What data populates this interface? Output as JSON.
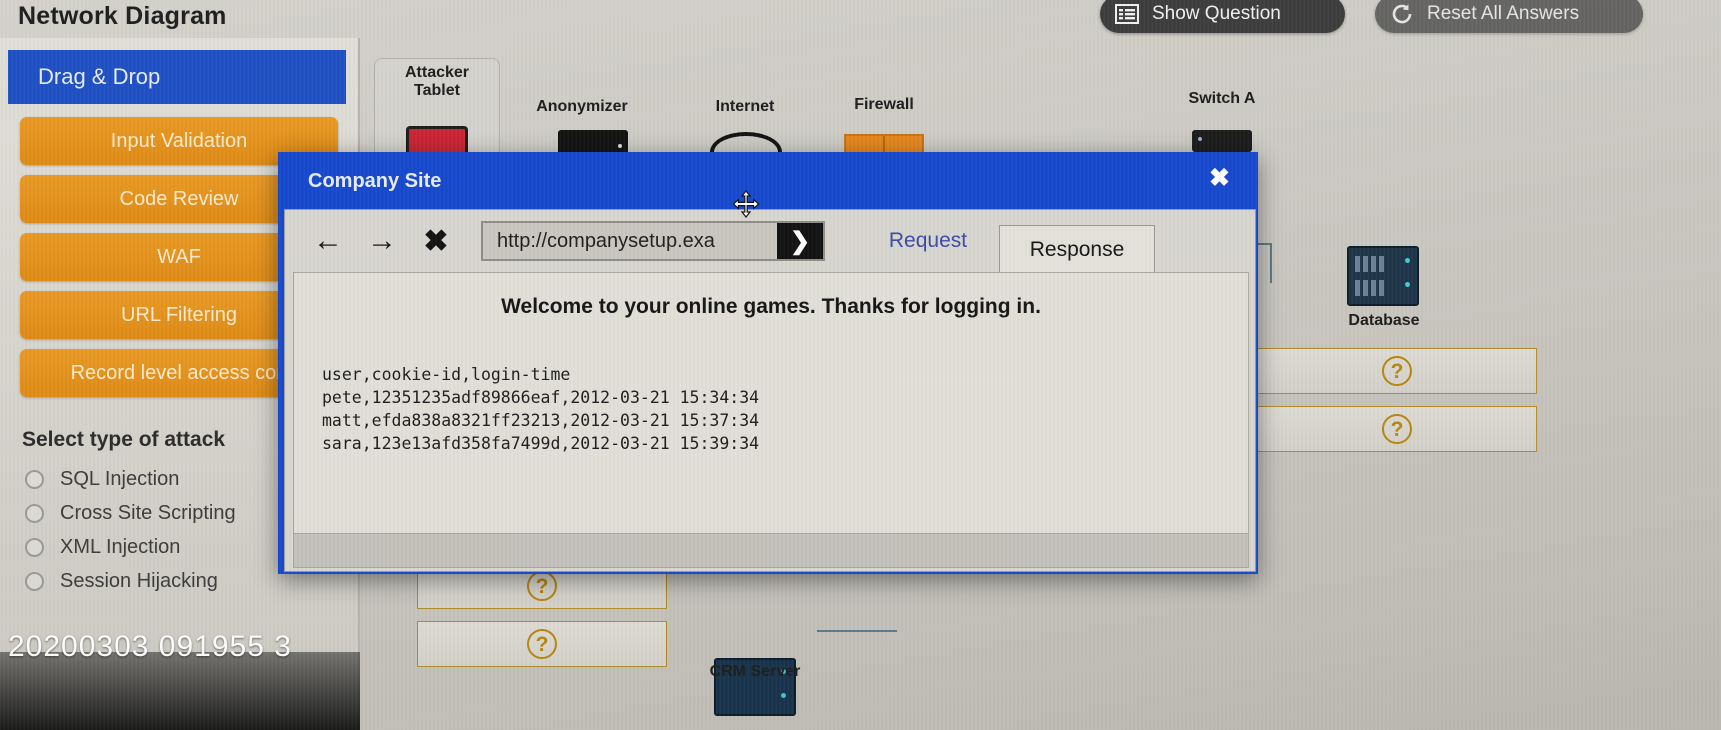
{
  "header": {
    "title": "Network Diagram",
    "show_question_label": "Show Question",
    "reset_label": "Reset All Answers"
  },
  "sidebar": {
    "dragdrop_header": "Drag & Drop",
    "drag_items": [
      {
        "label": "Input Validation"
      },
      {
        "label": "Code Review"
      },
      {
        "label": "WAF"
      },
      {
        "label": "URL Filtering"
      },
      {
        "label": "Record level access con"
      }
    ],
    "attack_title": "Select type of attack",
    "attack_options": [
      {
        "label": "SQL Injection",
        "selected": false
      },
      {
        "label": "Cross Site Scripting",
        "selected": false
      },
      {
        "label": "XML Injection",
        "selected": false
      },
      {
        "label": "Session Hijacking",
        "selected": false
      }
    ]
  },
  "timestamp": "20200303  091955  3",
  "diagram": {
    "nodes": [
      {
        "label": "Attacker\nTablet"
      },
      {
        "label": "Anonymizer"
      },
      {
        "label": "Internet"
      },
      {
        "label": "Firewall"
      },
      {
        "label": "Switch A"
      },
      {
        "label": "Database"
      },
      {
        "label": "CRM Server"
      }
    ],
    "dropzone_symbol": "?"
  },
  "modal": {
    "title": "Company Site",
    "close_label": "✖",
    "toolbar": {
      "back_icon_label": "←",
      "forward_icon_label": "→",
      "stop_icon_label": "✖",
      "url_value": "http://companysetup.exa",
      "url_placeholder": "http://",
      "go_label": "❯",
      "tab_request": "Request",
      "tab_response": "Response",
      "active_tab": "Response"
    },
    "content": {
      "welcome": "Welcome to your online games. Thanks for logging in.",
      "log_header": "user,cookie-id,login-time",
      "log_rows": [
        "pete,12351235adf89866eaf,2012-03-21 15:34:34",
        "matt,efda838a8321ff23213,2012-03-21 15:37:34",
        "sara,123e13afd358fa7499d,2012-03-21 15:39:34"
      ]
    }
  },
  "colors": {
    "modal_blue": "#1548cf",
    "drag_orange": "#e08b14",
    "sidebar_header_blue": "#1d4fc4",
    "qmark_gold": "#b8860b"
  }
}
